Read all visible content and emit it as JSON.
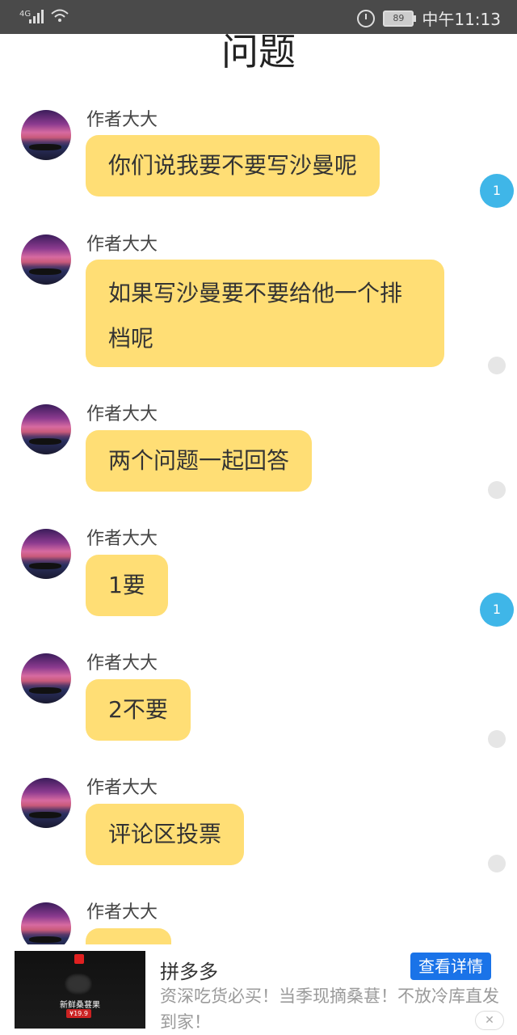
{
  "status_bar": {
    "network": "4G",
    "battery": "89",
    "time": "中午11:13"
  },
  "page": {
    "title": "问题"
  },
  "messages": [
    {
      "sender": "作者大大",
      "text": "你们说我要不要写沙曼呢",
      "status_count": "1"
    },
    {
      "sender": "作者大大",
      "text": "如果写沙曼要不要给他一个排档呢",
      "status_count": ""
    },
    {
      "sender": "作者大大",
      "text": "两个问题一起回答",
      "status_count": ""
    },
    {
      "sender": "作者大大",
      "text": "1要",
      "status_count": "1"
    },
    {
      "sender": "作者大大",
      "text": "2不要",
      "status_count": ""
    },
    {
      "sender": "作者大大",
      "text": "评论区投票",
      "status_count": ""
    },
    {
      "sender": "作者大大",
      "text": "",
      "status_count": ""
    }
  ],
  "ad": {
    "name": "拼多多",
    "cta": "查看详情",
    "description": "资深吃货必买！当季现摘桑葚！不放冷库直发到家！",
    "thumb_tagline": "新鲜桑葚果",
    "thumb_price": "¥19.9",
    "close_icon": "close-icon"
  }
}
